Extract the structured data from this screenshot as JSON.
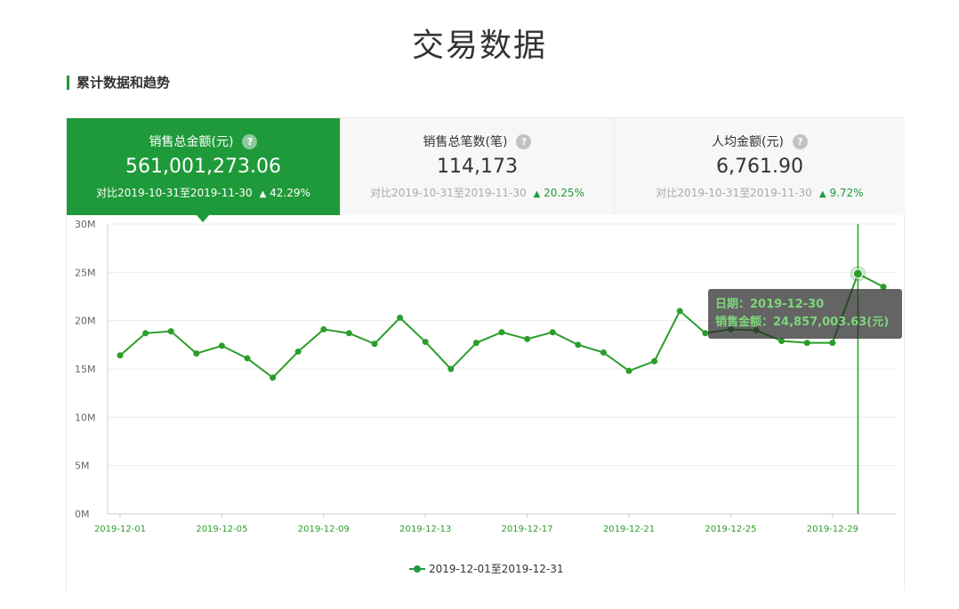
{
  "page": {
    "title": "交易数据",
    "section": "累计数据和趋势"
  },
  "cards": [
    {
      "label": "销售总金额(元)",
      "value": "561,001,273.06",
      "compare": "对比2019-10-31至2019-11-30",
      "change": "42.29%"
    },
    {
      "label": "销售总笔数(笔)",
      "value": "114,173",
      "compare": "对比2019-10-31至2019-11-30",
      "change": "20.25%"
    },
    {
      "label": "人均金额(元)",
      "value": "6,761.90",
      "compare": "对比2019-10-31至2019-11-30",
      "change": "9.72%"
    }
  ],
  "tooltip": {
    "date_line": "日期：2019-12-30",
    "value_line": "销售金额：24,857,003.63(元)"
  },
  "colors": {
    "accent": "#1f9a3a",
    "line": "#2a9d2a"
  },
  "chart_data": {
    "type": "line",
    "x": [
      "2019-12-01",
      "2019-12-02",
      "2019-12-03",
      "2019-12-04",
      "2019-12-05",
      "2019-12-06",
      "2019-12-07",
      "2019-12-08",
      "2019-12-09",
      "2019-12-10",
      "2019-12-11",
      "2019-12-12",
      "2019-12-13",
      "2019-12-14",
      "2019-12-15",
      "2019-12-16",
      "2019-12-17",
      "2019-12-18",
      "2019-12-19",
      "2019-12-20",
      "2019-12-21",
      "2019-12-22",
      "2019-12-23",
      "2019-12-24",
      "2019-12-25",
      "2019-12-26",
      "2019-12-27",
      "2019-12-28",
      "2019-12-29",
      "2019-12-30",
      "2019-12-31"
    ],
    "tick_labels": [
      "2019-12-01",
      "2019-12-05",
      "2019-12-09",
      "2019-12-13",
      "2019-12-17",
      "2019-12-21",
      "2019-12-25",
      "2019-12-29"
    ],
    "tick_indices": [
      0,
      4,
      8,
      12,
      16,
      20,
      24,
      28
    ],
    "y_ticks": [
      0,
      5000000,
      10000000,
      15000000,
      20000000,
      25000000,
      30000000
    ],
    "y_tick_labels": [
      "0M",
      "5M",
      "10M",
      "15M",
      "20M",
      "25M",
      "30M"
    ],
    "ylim": [
      0,
      30000000
    ],
    "series": [
      {
        "name": "2019-12-01至2019-12-31",
        "values": [
          16400000,
          18700000,
          18900000,
          16600000,
          17400000,
          16100000,
          14100000,
          16800000,
          19100000,
          18700000,
          17600000,
          20300000,
          17800000,
          15000000,
          17700000,
          18800000,
          18100000,
          18800000,
          17500000,
          16700000,
          14800000,
          15800000,
          21000000,
          18700000,
          19100000,
          19000000,
          17900000,
          17700000,
          17700000,
          24857003.63,
          23500000
        ]
      }
    ],
    "highlight_index": 29,
    "grid": true,
    "legend": "bottom-center"
  }
}
